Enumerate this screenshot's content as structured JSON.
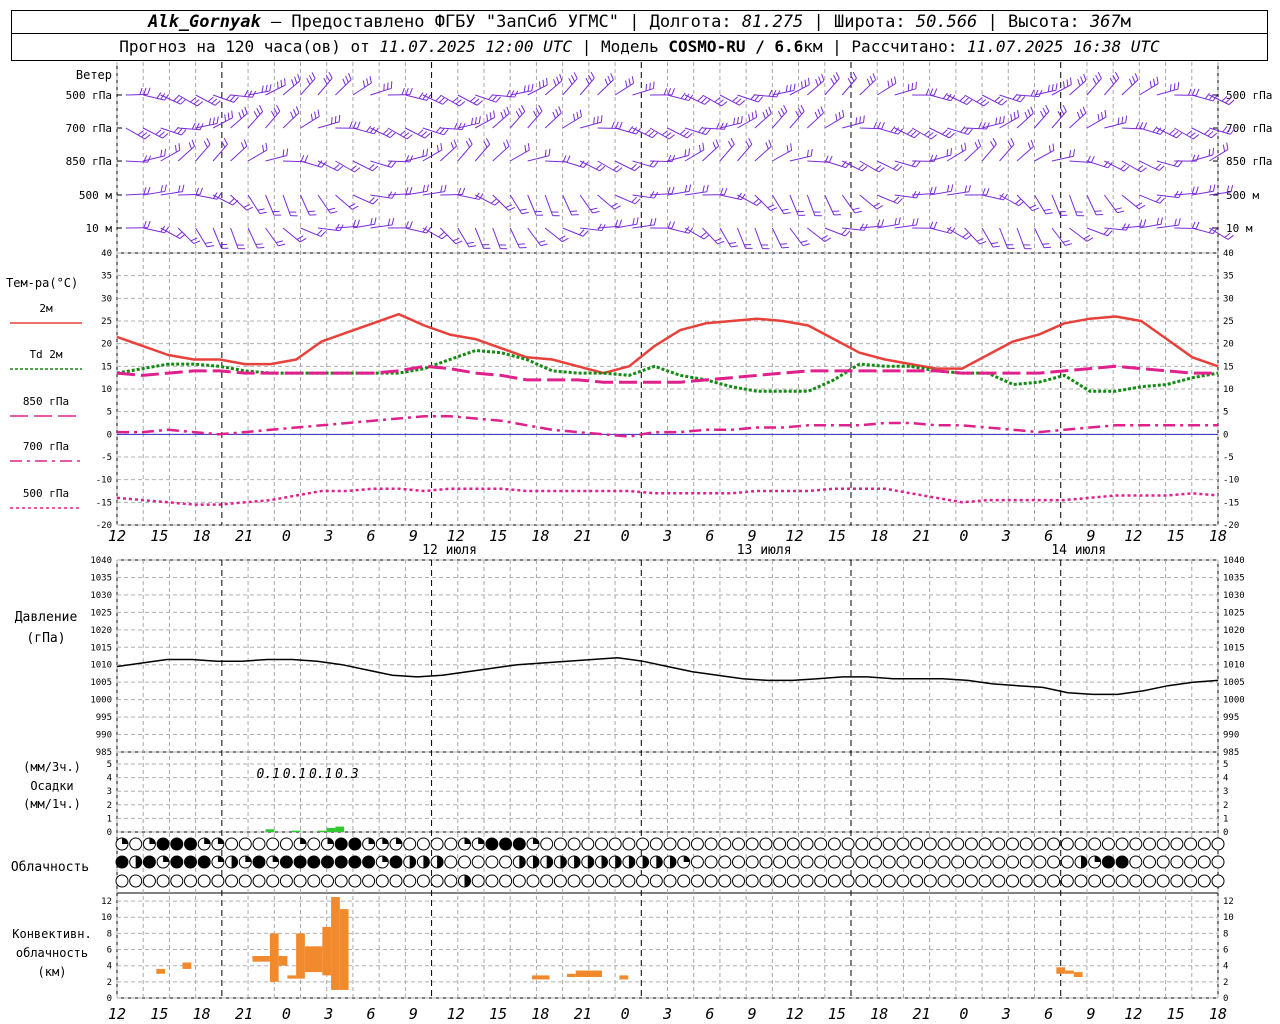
{
  "header": {
    "station": "Alk_Gornyak",
    "provider": "Предоставлено ФГБУ \"ЗапСиб УГМС\"",
    "lon_label": "Долгота:",
    "lon_value": "81.275",
    "lat_label": "Широта:",
    "lat_value": "50.566",
    "alt_label": "Высота:",
    "alt_value": "367",
    "alt_unit": "м",
    "forecast_prefix": "Прогноз на 120 часа(ов) от",
    "forecast_time": "11.07.2025 12:00 UTC",
    "model_label": "| Модель",
    "model_name": "COSMO-RU / 6.6",
    "model_unit": "км",
    "computed_label": "| Рассчитано:",
    "computed_time": "11.07.2025 16:38 UTC"
  },
  "chart_data": [
    {
      "type": "wind-barbs",
      "title": "Ветер",
      "levels": [
        "500 гПа",
        "700 гПа",
        "850 гПа",
        "500 м",
        "10  м"
      ]
    },
    {
      "type": "line",
      "ylabel": "Тем-ра(°С)",
      "ylim": [
        -20,
        40
      ],
      "yticks": [
        -20,
        -15,
        -10,
        -5,
        0,
        5,
        10,
        15,
        20,
        25,
        30,
        35,
        40
      ],
      "x_hours": [
        0,
        3,
        6,
        9,
        12,
        15,
        18,
        21,
        24,
        27,
        30,
        33,
        36,
        39,
        42,
        45,
        48,
        51,
        54,
        57,
        60,
        63,
        66,
        69,
        72,
        75,
        78,
        81,
        84,
        87,
        90,
        93,
        96,
        99,
        102,
        105,
        108,
        111,
        114,
        117,
        120,
        123,
        126
      ],
      "series": [
        {
          "name": "2м",
          "color": "#e8403a",
          "style": "solid",
          "values": [
            21.5,
            19.5,
            17.5,
            16.5,
            16.5,
            15.5,
            15.5,
            16.5,
            20.5,
            22.5,
            24.5,
            26.5,
            24,
            22,
            21,
            19,
            17,
            16.5,
            15,
            13.5,
            15,
            19.5,
            23,
            24.5,
            25,
            25.5,
            25,
            24,
            21,
            18,
            16.5,
            15.5,
            14.5,
            14.5,
            17.5,
            20.5,
            22,
            24.5,
            25.5,
            26,
            25,
            21,
            17,
            15
          ]
        },
        {
          "name": "Td  2м",
          "color": "#138a13",
          "style": "dotted",
          "values": [
            13.5,
            14.5,
            15.5,
            15.5,
            15,
            14,
            13.5,
            13.5,
            13.5,
            13.5,
            13.5,
            13.5,
            14.5,
            16.5,
            18.5,
            18,
            16.5,
            14,
            13.5,
            13.5,
            13,
            15,
            13,
            12,
            10.5,
            9.5,
            9.5,
            9.5,
            12,
            15.5,
            15,
            15,
            14,
            13.5,
            13.5,
            11,
            11.5,
            13,
            9.5,
            9.5,
            10.5,
            11,
            12.5,
            13.5
          ]
        },
        {
          "name": "850 гПа",
          "color": "#e0208c",
          "style": "dashed",
          "values": [
            13.5,
            13,
            13.5,
            14,
            14,
            13.5,
            13.5,
            13.5,
            13.5,
            13.5,
            13.5,
            14,
            15,
            14.5,
            13.5,
            13,
            12,
            12,
            12,
            11.5,
            11.5,
            11.5,
            11.5,
            12,
            12.5,
            13,
            13.5,
            14,
            14,
            14,
            14,
            14,
            14,
            13.5,
            13.5,
            13.5,
            13.5,
            14,
            14.5,
            15,
            14.5,
            14,
            13.5,
            13.5
          ]
        },
        {
          "name": "700 гПа",
          "color": "#e0208c",
          "style": "dashdot",
          "values": [
            0.5,
            0.5,
            1,
            0.5,
            0,
            0.5,
            1,
            1.5,
            2,
            2.5,
            3,
            3.5,
            4,
            4,
            3.5,
            3,
            2,
            1,
            0.5,
            0,
            -0.5,
            0.5,
            0.5,
            1,
            1,
            1.5,
            1.5,
            2,
            2,
            2,
            2.5,
            2.5,
            2,
            2,
            1.5,
            1,
            0.5,
            1,
            1.5,
            2,
            2,
            2,
            2,
            2
          ]
        },
        {
          "name": "500 гПа",
          "color": "#e0208c",
          "style": "fine",
          "values": [
            -14,
            -14.5,
            -15,
            -15.5,
            -15.5,
            -15,
            -14.5,
            -13.5,
            -12.5,
            -12.5,
            -12,
            -12,
            -12.5,
            -12,
            -12,
            -12,
            -12.5,
            -12.5,
            -12.5,
            -12.5,
            -12.5,
            -13,
            -13,
            -13,
            -13,
            -12.5,
            -12.5,
            -12.5,
            -12,
            -12,
            -12,
            -13,
            -14,
            -15,
            -14.5,
            -14.5,
            -14.5,
            -14.5,
            -14,
            -13.5,
            -13.5,
            -13.5,
            -13,
            -13.5
          ]
        }
      ],
      "xticks": [
        "12",
        "15",
        "18",
        "21",
        "0",
        "3",
        "6",
        "9",
        "12",
        "15",
        "18",
        "21",
        "0",
        "3",
        "6",
        "9",
        "12",
        "15",
        "18",
        "21",
        "0",
        "3",
        "6",
        "9",
        "12",
        "15",
        "18"
      ],
      "dates": [
        "12 июля",
        "13 июля",
        "14 июля"
      ]
    },
    {
      "type": "line",
      "ylabel": "Давление",
      "ylabel_unit": "(гПа)",
      "ylim": [
        985,
        1040
      ],
      "yticks": [
        985,
        990,
        995,
        1000,
        1005,
        1010,
        1015,
        1020,
        1025,
        1030,
        1035,
        1040
      ],
      "series": [
        {
          "name": "",
          "color": "#000000",
          "values": [
            1009.5,
            1010.5,
            1011.5,
            1011.5,
            1011,
            1011,
            1011.5,
            1011.5,
            1011,
            1010,
            1008.5,
            1007,
            1006.5,
            1007,
            1008,
            1009,
            1010,
            1010.5,
            1011,
            1011.5,
            1012,
            1011,
            1009.5,
            1008,
            1007,
            1006,
            1005.5,
            1005.5,
            1006,
            1006.5,
            1006.5,
            1006,
            1006,
            1006,
            1005.5,
            1004.5,
            1004,
            1003.5,
            1002,
            1001.5,
            1001.5,
            1002.5,
            1004,
            1005,
            1005.5
          ]
        }
      ]
    },
    {
      "type": "bar",
      "ylabel": "Осадки",
      "ylabel_unit": "(мм/3ч.)",
      "ylabel_unit2": "(мм/1ч.)",
      "ylim": [
        0,
        5
      ],
      "yticks": [
        0,
        1,
        2,
        3,
        4,
        5
      ],
      "color": "#32c832",
      "labels": [
        {
          "text": "0.1",
          "hour": 18
        },
        {
          "text": "0.1",
          "hour": 21
        },
        {
          "text": "0.1",
          "hour": 24
        },
        {
          "text": "0.3",
          "hour": 27
        }
      ],
      "bars": [
        {
          "start_h": 17,
          "end_h": 18,
          "value": 0.2
        },
        {
          "start_h": 20,
          "end_h": 21,
          "value": 0.1
        },
        {
          "start_h": 23,
          "end_h": 24,
          "value": 0.1
        },
        {
          "start_h": 24,
          "end_h": 25,
          "value": 0.3
        },
        {
          "start_h": 25,
          "end_h": 26,
          "value": 0.4
        }
      ]
    },
    {
      "type": "cloud-symbols",
      "ylabel": "Облачность",
      "rows": [
        "qoqbbbqqoooooqoqbbqqqooooqqbbbqoooooooooooooooooooooooooooooooooooooooooooooooooo",
        "bhbqbbbqhqbqbbbbbbbqbhhhooooohhhhhhhhhhhhqoooooooooooooooooooooooooooohqbbooooooooohhhhhhhooooooo",
        "ooooooooooooooooooooooooohoooooooooooooooooooooooooooooooooooooooooooooooooooooo"
      ]
    },
    {
      "type": "bar",
      "ylabel": "Конвективн.",
      "ylabel_unit": "облачность",
      "ylabel_unit2": "(км)",
      "ylim": [
        0,
        13
      ],
      "yticks": [
        0,
        2,
        4,
        6,
        8,
        10,
        12
      ],
      "color": "#f08a2c",
      "bars": [
        {
          "start_h": 4.5,
          "end_h": 5.5,
          "bottom": 3,
          "top": 3.6
        },
        {
          "start_h": 7.5,
          "end_h": 8.5,
          "bottom": 3.6,
          "top": 4.4
        },
        {
          "start_h": 15.5,
          "end_h": 17.5,
          "bottom": 4.5,
          "top": 5.2
        },
        {
          "start_h": 17.5,
          "end_h": 18.5,
          "bottom": 2,
          "top": 8
        },
        {
          "start_h": 18.5,
          "end_h": 19.5,
          "bottom": 4,
          "top": 5.2
        },
        {
          "start_h": 19.5,
          "end_h": 20.5,
          "bottom": 2.4,
          "top": 2.8
        },
        {
          "start_h": 20.5,
          "end_h": 21.5,
          "bottom": 2.4,
          "top": 8
        },
        {
          "start_h": 21.5,
          "end_h": 23.5,
          "bottom": 3.2,
          "top": 6.4
        },
        {
          "start_h": 23.5,
          "end_h": 24.5,
          "bottom": 2.8,
          "top": 8.8
        },
        {
          "start_h": 24.5,
          "end_h": 25.5,
          "bottom": 1,
          "top": 12.5
        },
        {
          "start_h": 25.5,
          "end_h": 26.5,
          "bottom": 1,
          "top": 11
        },
        {
          "start_h": 47.5,
          "end_h": 49.5,
          "bottom": 2.3,
          "top": 2.8
        },
        {
          "start_h": 51.5,
          "end_h": 52.5,
          "bottom": 2.6,
          "top": 3
        },
        {
          "start_h": 52.5,
          "end_h": 55.5,
          "bottom": 2.6,
          "top": 3.4
        },
        {
          "start_h": 57.5,
          "end_h": 58.5,
          "bottom": 2.3,
          "top": 2.8
        },
        {
          "start_h": 107.5,
          "end_h": 108.5,
          "bottom": 3,
          "top": 3.8
        },
        {
          "start_h": 108.5,
          "end_h": 109.5,
          "bottom": 3,
          "top": 3.4
        },
        {
          "start_h": 109.5,
          "end_h": 110.5,
          "bottom": 2.6,
          "top": 3.2
        }
      ]
    }
  ]
}
